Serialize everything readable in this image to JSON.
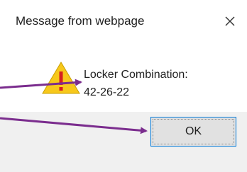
{
  "dialog": {
    "title": "Message from webpage",
    "close_symbol": "×",
    "icon": "warning-icon",
    "message_line1": "Locker Combination:",
    "message_line2": "42-26-22",
    "ok_label": "OK"
  },
  "colors": {
    "annotation_arrow": "#7b2d8e",
    "warning_yellow": "#f7c81b",
    "button_border": "#0078d7",
    "footer_bg": "#f0f0f0"
  }
}
